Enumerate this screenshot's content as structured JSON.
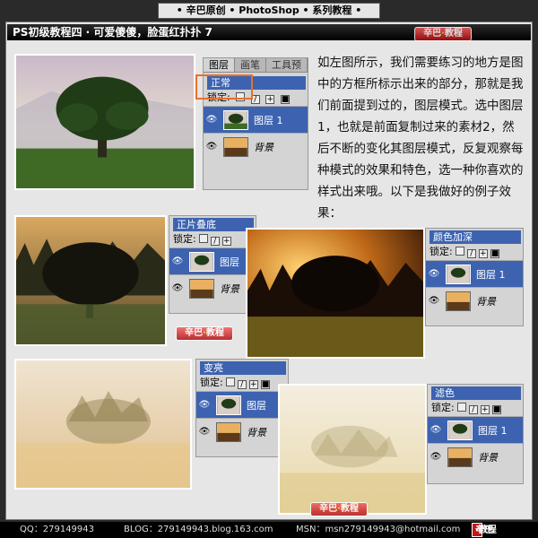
{
  "header": {
    "title": "• 辛巴原创 • PhotoShop • 系列教程 •",
    "lesson_title": "PS初级教程四 · 可爱傻傻，脸蛋红扑扑 7"
  },
  "watermark": {
    "text_a": "辛巴",
    "sep": "·",
    "text_b": "教程"
  },
  "main_panel": {
    "tabs": [
      "图层",
      "画笔",
      "工具预"
    ],
    "blend_mode": "正常",
    "lock_label": "锁定:",
    "layers": [
      {
        "name": "图层 1",
        "selected": true,
        "visible_icon": "eye-icon"
      },
      {
        "name": "背景",
        "selected": false,
        "visible_icon": "eye-icon"
      }
    ]
  },
  "description": "如左图所示，我们需要练习的地方是图中的方框所标示出来的部分，那就是我们前面提到过的，图层模式。选中图层1，也就是前面复制过来的素材2，然后不断的变化其图层模式，反复观察每种模式的效果和特色，选一种你喜欢的样式出来哦。以下是我做好的例子效果：",
  "examples": [
    {
      "mode": "正片叠底",
      "lock_label": "锁定:",
      "layer1": "图层",
      "layer2": "背景"
    },
    {
      "mode": "颜色加深",
      "lock_label": "锁定:",
      "layer1": "图层 1",
      "layer2": "背景"
    },
    {
      "mode": "变亮",
      "lock_label": "锁定:",
      "layer1": "图层",
      "layer2": "背景"
    },
    {
      "mode": "滤色",
      "lock_label": "锁定:",
      "layer1": "图层 1",
      "layer2": "背景"
    }
  ],
  "footer": {
    "qq": "QQ：279149943",
    "blog": "BLOG：279149943.blog.163.com",
    "msn": "MSN：msn279149943@hotmail.com",
    "badge_a": "辛巴",
    "badge_b": "教程"
  },
  "colors": {
    "accent_blue": "#3d63b0",
    "highlight_orange": "#e8702a",
    "watermark_red": "#d02020"
  }
}
